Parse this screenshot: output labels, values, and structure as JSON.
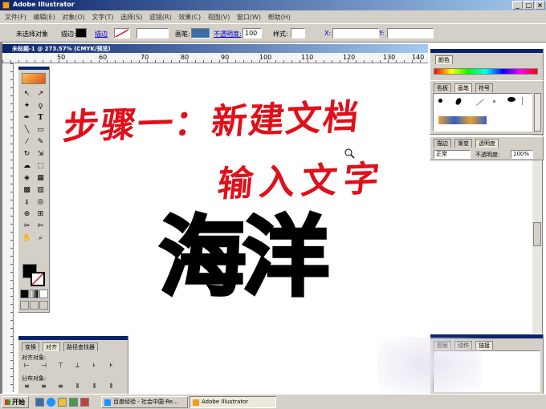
{
  "window": {
    "title": "Adobe Illustrator",
    "buttons": [
      "_",
      "□",
      "×"
    ]
  },
  "menu": {
    "items": [
      "文件(F)",
      "编辑(E)",
      "对象(O)",
      "文字(T)",
      "选择(S)",
      "滤镜(R)",
      "效果(C)",
      "视图(V)",
      "窗口(W)",
      "帮助(H)"
    ]
  },
  "control_bar": {
    "no_selection": "未选择对象",
    "fill_label": "描边:",
    "stroke_label": "描边",
    "opacity_label": "不透明度:",
    "opacity_value": "100",
    "style_label": "样式:",
    "brush_label": "画笔:",
    "x_label": "X:",
    "y_label": "Y:"
  },
  "document": {
    "tab_title": "未标题-1 @ 273.57% (CMYK/预览)",
    "ruler_numbers": [
      "50",
      "60",
      "70",
      "80",
      "90",
      "100",
      "110",
      "120",
      "130",
      "140"
    ]
  },
  "canvas": {
    "handwriting_line1": "步骤一：新建文档",
    "handwriting_line2": "输入文字",
    "main_text": "海洋",
    "handwriting_color": "#e0101a"
  },
  "panels": {
    "color": {
      "tab": "颜色"
    },
    "brushes": {
      "tabs": [
        "色板",
        "画笔",
        "符号"
      ],
      "active": "画笔"
    },
    "transparency": {
      "tabs": [
        "描边",
        "渐变",
        "透明度"
      ],
      "mode": "正常",
      "opacity_label": "不透明度:",
      "opacity_value": "100%"
    },
    "layers": {
      "tabs": [
        "图层",
        "动作",
        "链接"
      ],
      "title": "图层"
    },
    "align": {
      "tabs": [
        "变换",
        "对齐",
        "路径查找器"
      ],
      "align_objects": "对齐对象:",
      "distribute_objects": "分布对象:"
    }
  },
  "taskbar": {
    "start": "开始",
    "items": [
      "百度经验 - 社会中国·Re...",
      "Adobe Illustrator"
    ]
  },
  "colors": {
    "chrome": "#d4d0c8",
    "title_gradient_start": "#0a246a",
    "title_gradient_end": "#a6caf0",
    "ink": "#000000"
  }
}
